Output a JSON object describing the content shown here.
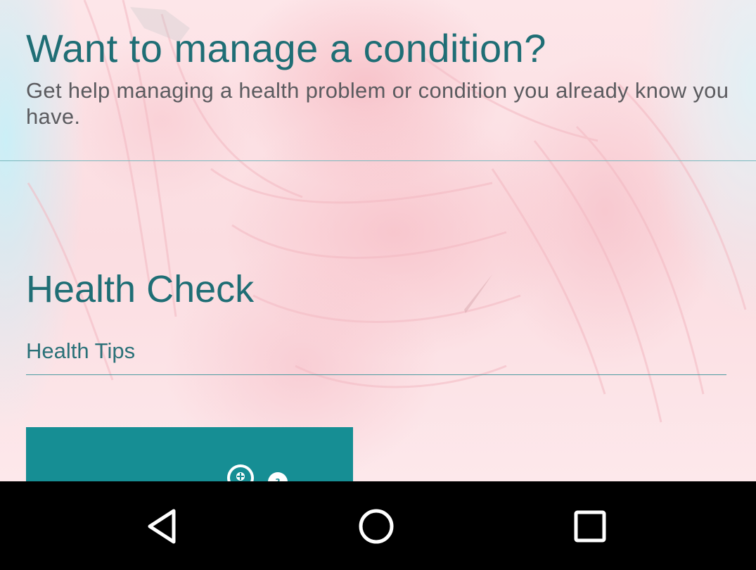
{
  "condition_section": {
    "title": "Want to manage a condition?",
    "description": "Get help managing a health problem or condition you already know you have."
  },
  "health_check": {
    "title": "Health Check",
    "tips_link": "Health Tips"
  },
  "colors": {
    "title_teal": "#1f6e75",
    "card_teal": "#168e94",
    "navbar": "#000000"
  },
  "nav": {
    "back_icon": "back-triangle-icon",
    "home_icon": "home-circle-icon",
    "recent_icon": "recent-apps-square-icon"
  }
}
